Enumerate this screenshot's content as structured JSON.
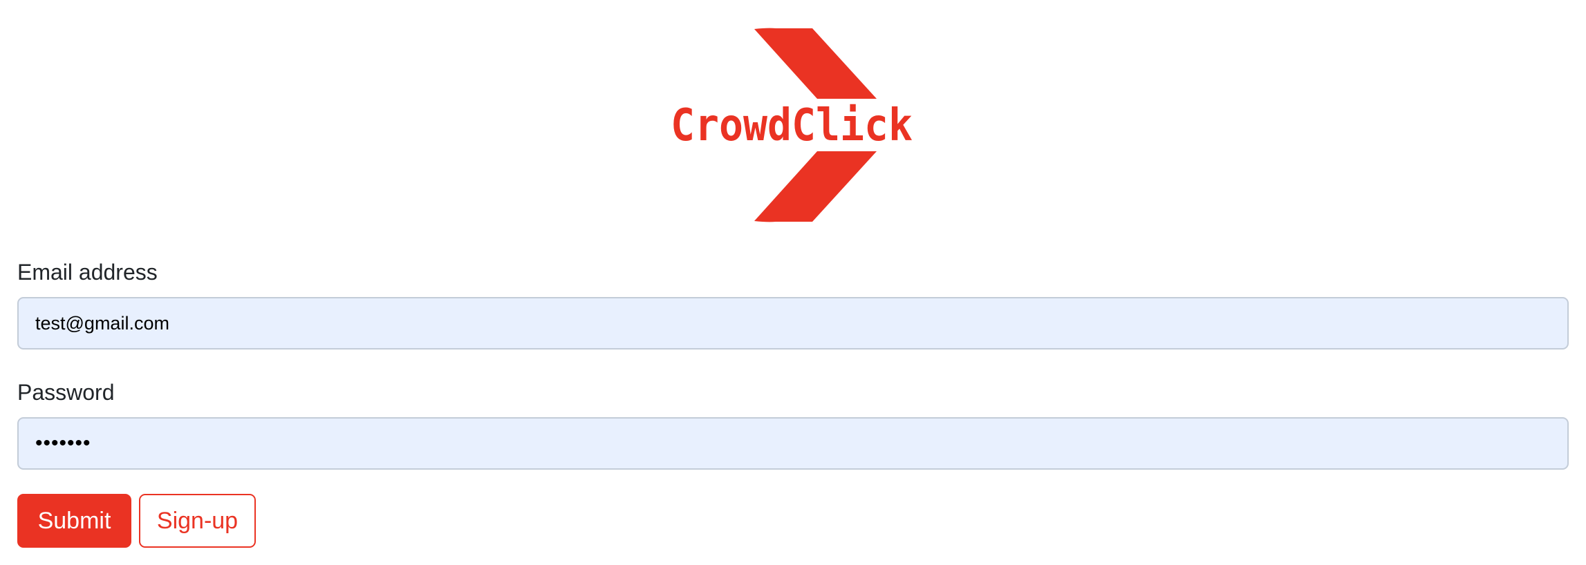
{
  "logo": {
    "text": "CrowdClick",
    "color": "#ea3323"
  },
  "form": {
    "email": {
      "label": "Email address",
      "value": "test@gmail.com"
    },
    "password": {
      "label": "Password",
      "value": "•••••••"
    },
    "submit_label": "Submit",
    "signup_label": "Sign-up"
  },
  "colors": {
    "accent": "#ea3323",
    "input_bg": "#e8f0fe",
    "input_border": "#c3ccd8"
  }
}
